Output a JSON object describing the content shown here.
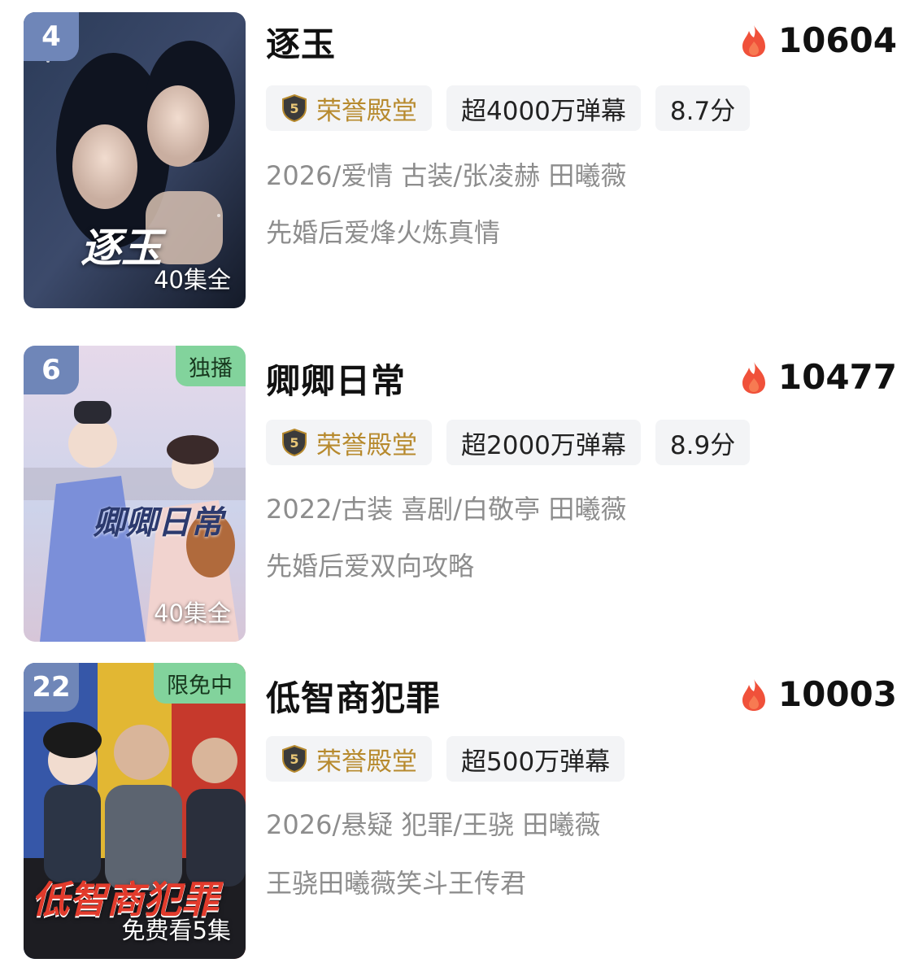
{
  "items": [
    {
      "rank": "4",
      "corner_badge": "",
      "poster_title": "逐玉",
      "episodes": "40集全",
      "title": "逐玉",
      "heat": "10604",
      "honor": "荣誉殿堂",
      "honor_badge": "5",
      "danmaku": "超4000万弹幕",
      "score": "8.7分",
      "info": "2026/爱情 古装/张凌赫 田曦薇",
      "tagline": "先婚后爱烽火炼真情"
    },
    {
      "rank": "6",
      "corner_badge": "独播",
      "poster_title": "卿卿日常",
      "episodes": "40集全",
      "title": "卿卿日常",
      "heat": "10477",
      "honor": "荣誉殿堂",
      "honor_badge": "5",
      "danmaku": "超2000万弹幕",
      "score": "8.9分",
      "info": "2022/古装 喜剧/白敬亭 田曦薇",
      "tagline": "先婚后爱双向攻略"
    },
    {
      "rank": "22",
      "corner_badge": "限免中",
      "poster_title": "低智商犯罪",
      "episodes": "免费看5集",
      "title": "低智商犯罪",
      "heat": "10003",
      "honor": "荣誉殿堂",
      "honor_badge": "5",
      "danmaku": "超500万弹幕",
      "score": "",
      "info": "2026/悬疑 犯罪/王骁 田曦薇",
      "tagline": "王骁田曦薇笑斗王传君"
    }
  ],
  "colors": {
    "accent_gold": "#b78a2e",
    "flame": "#f0513a",
    "rank_bg": "#6f86b8",
    "badge_green": "#82d39c"
  },
  "icons": {
    "heat": "flame-icon",
    "honor": "shield-badge-icon"
  }
}
